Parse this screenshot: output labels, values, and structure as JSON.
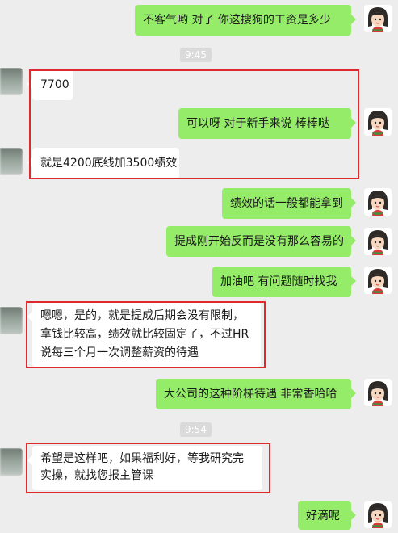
{
  "chat": {
    "messages": [
      {
        "text": "不客气哟   对了   你这搜狗的工资是多少"
      },
      {
        "text": "7700"
      },
      {
        "text": "可以呀   对于新手来说   棒棒哒"
      },
      {
        "text": "就是4200底线加3500绩效"
      },
      {
        "text": "绩效的话一般都能拿到"
      },
      {
        "text": "提成刚开始反而是没有那么容易的"
      },
      {
        "text": "加油吧   有问题随时找我"
      },
      {
        "text": "嗯嗯，是的，就是提成后期会没有限制，拿钱比较高，绩效就比较固定了，不过HR说每三个月一次调整薪资的待遇"
      },
      {
        "text": "大公司的这种阶梯待遇   非常香哈哈"
      },
      {
        "text": "希望是这样吧，如果福利好，等我研究完实操，就找您报主管课"
      },
      {
        "text": "好滴呢"
      }
    ],
    "timestamps": [
      "9:45",
      "9:54"
    ]
  },
  "colors": {
    "sent_bubble": "#95ec69",
    "received_bubble": "#ffffff",
    "background": "#ededed",
    "highlight_box": "#e0282f"
  }
}
